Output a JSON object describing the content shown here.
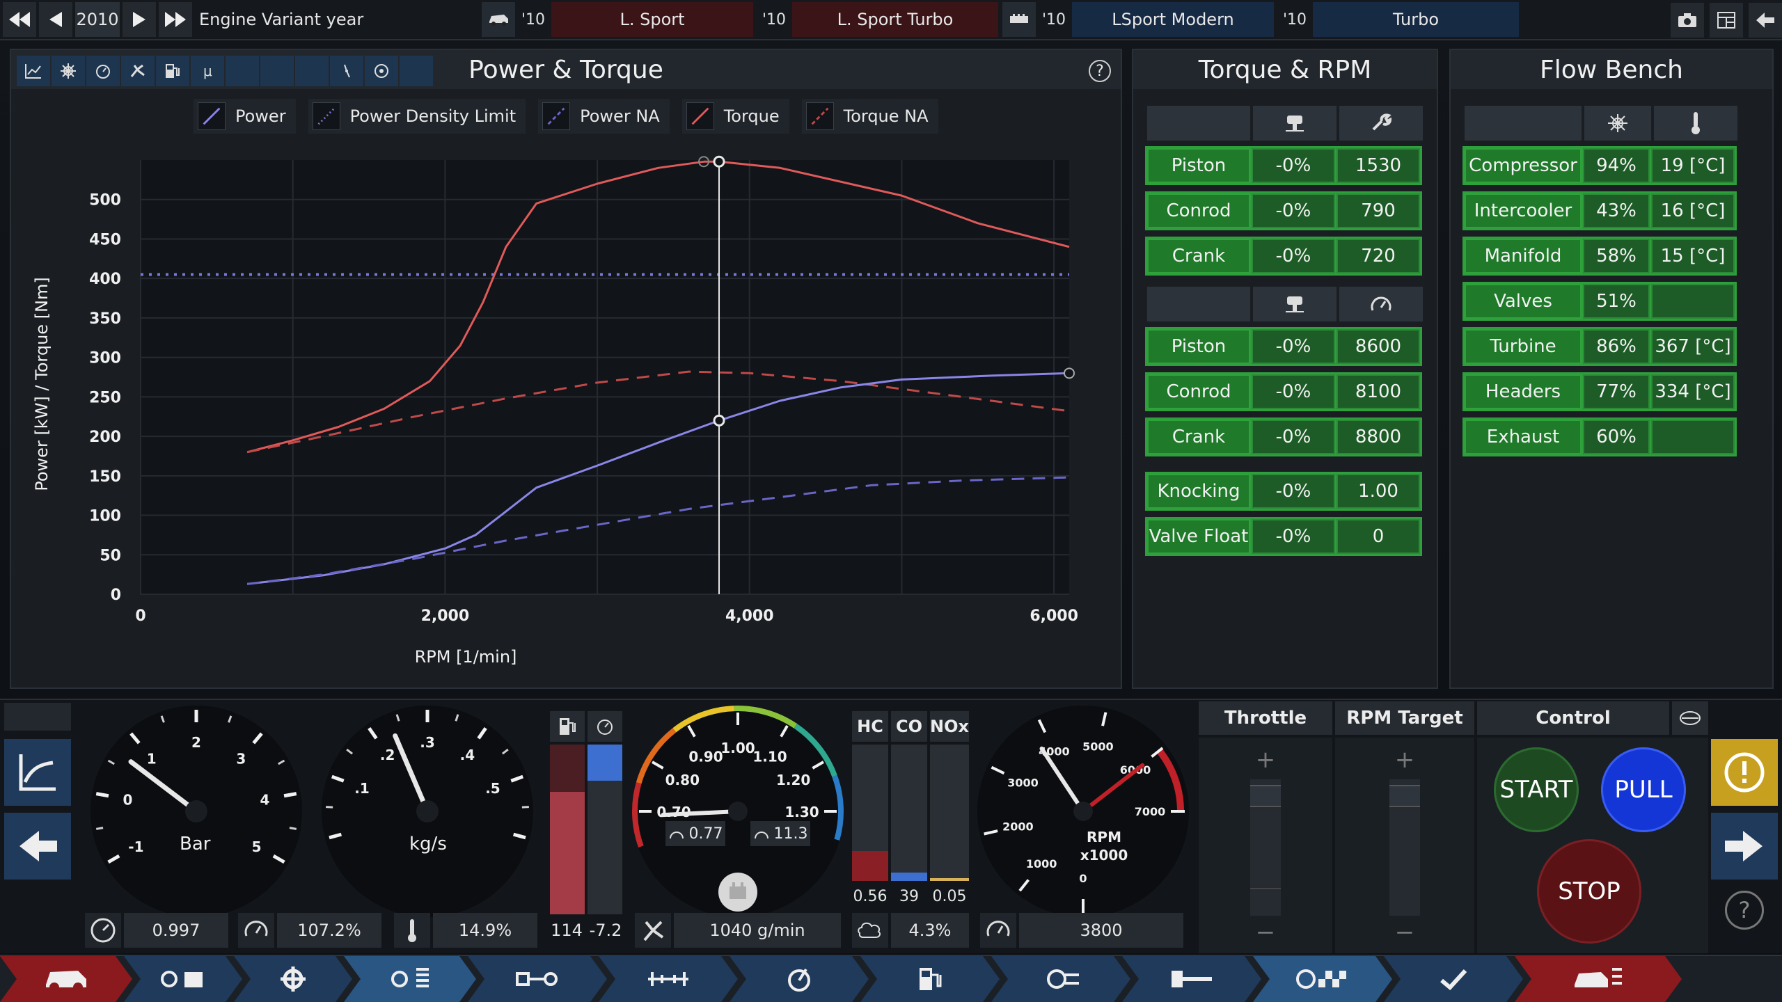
{
  "topbar": {
    "year": "2010",
    "label": "Engine Variant year",
    "variants": [
      {
        "year": "'10",
        "name": "L. Sport",
        "style": "red"
      },
      {
        "year": "'10",
        "name": "L. Sport Turbo",
        "style": "red"
      },
      {
        "year": "'10",
        "name": "LSport Modern",
        "style": "blue"
      },
      {
        "year": "'10",
        "name": "Turbo",
        "style": "blue"
      }
    ]
  },
  "power_torque": {
    "title": "Power & Torque",
    "help": "?",
    "legend": [
      "Power",
      "Power Density Limit",
      "Power NA",
      "Torque",
      "Torque NA"
    ]
  },
  "chart_data": {
    "type": "line",
    "xlabel": "RPM [1/min]",
    "ylabel": "Power [kW] / Torque [Nm]",
    "xlim": [
      0,
      6100
    ],
    "ylim": [
      0,
      550
    ],
    "xticks": [
      0,
      2000,
      4000,
      6000
    ],
    "xtick_labels": [
      "0",
      "2,000",
      "4,000",
      "6,000"
    ],
    "yticks": [
      0,
      50,
      100,
      150,
      200,
      250,
      300,
      350,
      400,
      450,
      500
    ],
    "grid": true,
    "cursor_rpm": 3800,
    "series": [
      {
        "name": "Torque",
        "color": "#e05a5a",
        "dash": "solid",
        "x": [
          700,
          1000,
          1300,
          1600,
          1900,
          2100,
          2250,
          2400,
          2600,
          3000,
          3400,
          3700,
          3800,
          4200,
          5000,
          5500,
          6100
        ],
        "y": [
          180,
          195,
          212,
          235,
          270,
          315,
          370,
          440,
          495,
          520,
          540,
          548,
          548,
          540,
          505,
          470,
          440
        ]
      },
      {
        "name": "Torque NA",
        "color": "#c04a4a",
        "dash": "dashed",
        "x": [
          700,
          1200,
          1800,
          2400,
          3000,
          3600,
          4000,
          4600,
          5200,
          6100
        ],
        "y": [
          180,
          200,
          225,
          248,
          268,
          282,
          280,
          270,
          255,
          232
        ]
      },
      {
        "name": "Power",
        "color": "#8a86e8",
        "dash": "solid",
        "x": [
          700,
          1200,
          1600,
          2000,
          2200,
          2400,
          2600,
          3000,
          3400,
          3800,
          4200,
          4600,
          5000,
          5600,
          6100
        ],
        "y": [
          13,
          24,
          38,
          58,
          75,
          105,
          135,
          163,
          192,
          220,
          245,
          262,
          272,
          277,
          280
        ]
      },
      {
        "name": "Power NA",
        "color": "#6a66c8",
        "dash": "dashed",
        "x": [
          700,
          1200,
          1800,
          2400,
          3000,
          3600,
          4200,
          4800,
          5400,
          6100
        ],
        "y": [
          13,
          25,
          45,
          68,
          88,
          108,
          123,
          138,
          144,
          148
        ]
      },
      {
        "name": "Power Density Limit",
        "color": "#7a76d8",
        "dash": "dotted",
        "x": [
          0,
          6100
        ],
        "y": [
          405,
          405
        ]
      }
    ]
  },
  "torque_rpm": {
    "title": "Torque & RPM",
    "group1": [
      {
        "name": "Piston",
        "pct": "-0%",
        "val": "1530"
      },
      {
        "name": "Conrod",
        "pct": "-0%",
        "val": "790"
      },
      {
        "name": "Crank",
        "pct": "-0%",
        "val": "720"
      }
    ],
    "group2": [
      {
        "name": "Piston",
        "pct": "-0%",
        "val": "8600"
      },
      {
        "name": "Conrod",
        "pct": "-0%",
        "val": "8100"
      },
      {
        "name": "Crank",
        "pct": "-0%",
        "val": "8800"
      }
    ],
    "group3": [
      {
        "name": "Knocking",
        "pct": "-0%",
        "val": "1.00"
      },
      {
        "name": "Valve Float",
        "pct": "-0%",
        "val": "0"
      }
    ]
  },
  "flow_bench": {
    "title": "Flow Bench",
    "rows": [
      {
        "name": "Compressor",
        "pct": "94%",
        "temp": "19 [°C]"
      },
      {
        "name": "Intercooler",
        "pct": "43%",
        "temp": "16 [°C]"
      },
      {
        "name": "Manifold",
        "pct": "58%",
        "temp": "15 [°C]"
      },
      {
        "name": "Valves",
        "pct": "51%",
        "temp": ""
      },
      {
        "name": "Turbine",
        "pct": "86%",
        "temp": "367 [°C]"
      },
      {
        "name": "Headers",
        "pct": "77%",
        "temp": "334 [°C]"
      },
      {
        "name": "Exhaust",
        "pct": "60%",
        "temp": ""
      }
    ]
  },
  "gauges": {
    "bar": {
      "unit": "Bar",
      "ticks": [
        "-1",
        "0",
        "1",
        "2",
        "3",
        "4",
        "5"
      ],
      "readout_a": "0.997",
      "readout_b": "107.2%"
    },
    "kgs": {
      "unit": "kg/s",
      "ticks": [
        ".1",
        ".2",
        ".3",
        ".4",
        ".5"
      ],
      "readout": "14.9%"
    },
    "fuel": {
      "left": "114",
      "right": "-7.2",
      "flow": "1040 g/min",
      "left_level": 0.72,
      "right_level": 0.86
    },
    "lambda": {
      "ticks": [
        "0.70",
        "0.80",
        "0.90",
        "1.00",
        "1.10",
        "1.20",
        "1.30"
      ],
      "sub_a": "0.77",
      "sub_b": "11.3"
    },
    "emissions": {
      "labels": [
        "HC",
        "CO",
        "NOx"
      ],
      "values": [
        "0.56",
        "39",
        "0.05"
      ],
      "readout": "4.3%",
      "levels": [
        0.22,
        0.06,
        0.02
      ]
    },
    "rpm": {
      "label": "RPM",
      "sub": "x1000",
      "ticks": [
        "0",
        "1000",
        "2000",
        "3000",
        "4000",
        "5000",
        "6000",
        "7000"
      ],
      "readout": "3800"
    }
  },
  "controls": {
    "throttle": "Throttle",
    "rpm_target": "RPM Target",
    "control": "Control",
    "start": "START",
    "pull": "PULL",
    "stop": "STOP",
    "plus": "+",
    "minus": "−"
  },
  "colors": {
    "accent_blue": "#1f3a5a",
    "green_cell": "#1f7a2a",
    "red_variant": "#3a1416",
    "blue_variant": "#172a44",
    "start": "#1e4a22",
    "pull": "#1436d6",
    "stop": "#5a1214"
  }
}
